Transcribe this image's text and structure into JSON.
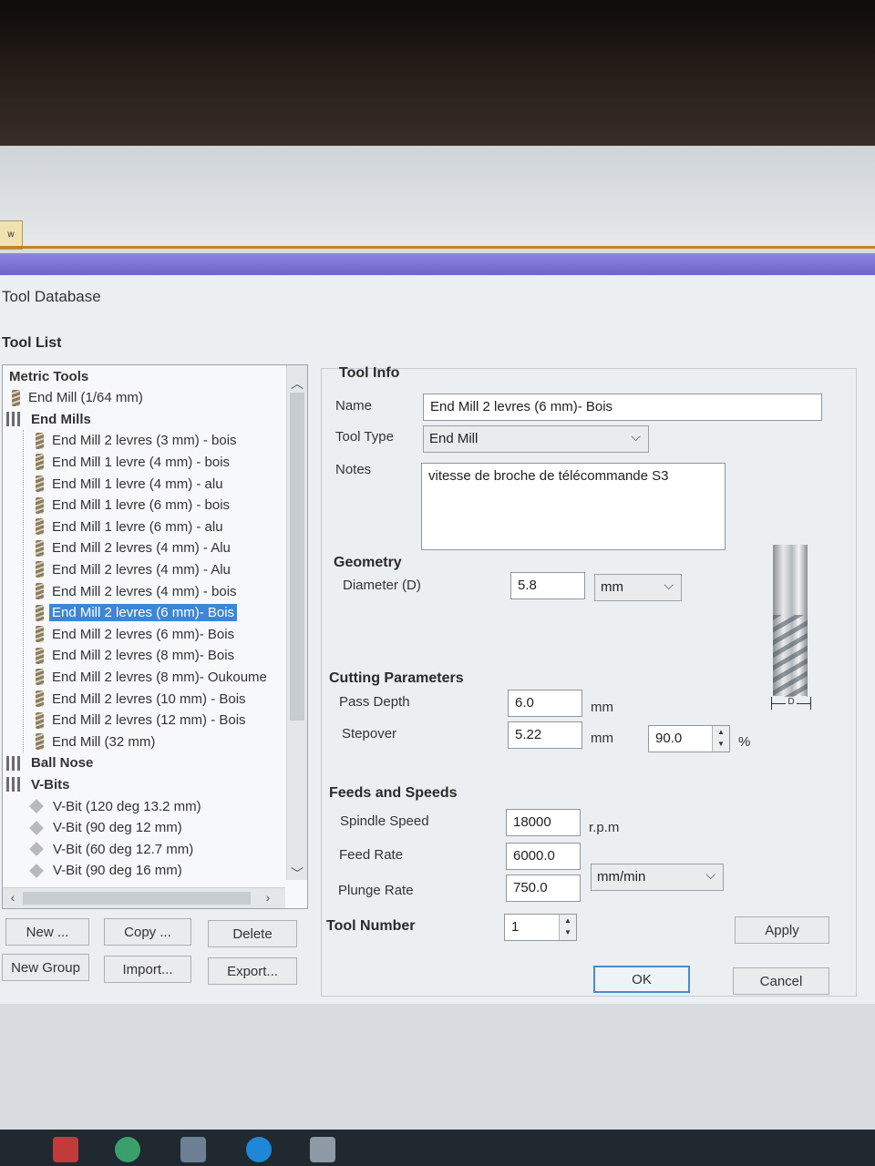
{
  "app_tab": {
    "label": "w"
  },
  "dialog": {
    "title": "Tool Database"
  },
  "tool_list": {
    "title": "Tool List",
    "items": [
      {
        "label": "Metric Tools",
        "kind": "root"
      },
      {
        "label": "End Mill (1/64 mm)",
        "kind": "tool"
      },
      {
        "label": "End Mills",
        "kind": "group"
      },
      {
        "label": "End Mill 2 levres (3 mm) - bois",
        "kind": "child"
      },
      {
        "label": "End Mill 1 levre (4 mm) - bois",
        "kind": "child"
      },
      {
        "label": "End Mill 1 levre (4 mm) - alu",
        "kind": "child"
      },
      {
        "label": "End Mill 1 levre (6 mm) - bois",
        "kind": "child"
      },
      {
        "label": "End Mill 1 levre (6 mm) - alu",
        "kind": "child"
      },
      {
        "label": "End Mill 2 levres (4 mm) - Alu",
        "kind": "child"
      },
      {
        "label": "End Mill 2 levres (4 mm) - Alu",
        "kind": "child"
      },
      {
        "label": "End Mill 2 levres (4 mm) - bois",
        "kind": "child"
      },
      {
        "label": "End Mill 2 levres (6 mm)- Bois",
        "kind": "child",
        "selected": true
      },
      {
        "label": "End Mill 2 levres (6 mm)- Bois",
        "kind": "child"
      },
      {
        "label": "End Mill 2 levres (8 mm)- Bois",
        "kind": "child"
      },
      {
        "label": "End Mill 2 levres (8 mm)- Oukoume",
        "kind": "child"
      },
      {
        "label": "End Mill 2 levres (10 mm) - Bois",
        "kind": "child"
      },
      {
        "label": "End Mill 2 levres (12 mm) - Bois",
        "kind": "child"
      },
      {
        "label": "End Mill (32 mm)",
        "kind": "child"
      },
      {
        "label": "Ball Nose",
        "kind": "group"
      },
      {
        "label": "V-Bits",
        "kind": "group"
      },
      {
        "label": "V-Bit (120 deg 13.2 mm)",
        "kind": "vbit"
      },
      {
        "label": "V-Bit (90 deg 12 mm)",
        "kind": "vbit"
      },
      {
        "label": "V-Bit (60 deg 12.7 mm)",
        "kind": "vbit"
      },
      {
        "label": "V-Bit (90 deg 16 mm)",
        "kind": "vbit"
      }
    ]
  },
  "buttons": {
    "new": "New ...",
    "copy": "Copy ...",
    "delete": "Delete",
    "new_group": "New Group",
    "import": "Import...",
    "export": "Export...",
    "apply": "Apply",
    "ok": "OK",
    "cancel": "Cancel"
  },
  "tool_info": {
    "title": "Tool Info",
    "name_label": "Name",
    "name_value": "End Mill 2 levres (6 mm)- Bois",
    "type_label": "Tool Type",
    "type_value": "End Mill",
    "notes_label": "Notes",
    "notes_value": "vitesse de broche de télécommande S3"
  },
  "geometry": {
    "title": "Geometry",
    "diameter_label": "Diameter (D)",
    "diameter_value": "5.8",
    "unit_value": "mm",
    "diagram_label": "D"
  },
  "cutting": {
    "title": "Cutting Parameters",
    "pass_depth_label": "Pass Depth",
    "pass_depth_value": "6.0",
    "pass_depth_unit": "mm",
    "stepover_label": "Stepover",
    "stepover_value": "5.22",
    "stepover_unit": "mm",
    "stepover_percent": "90.0",
    "percent_sign": "%"
  },
  "feeds": {
    "title": "Feeds and Speeds",
    "spindle_label": "Spindle Speed",
    "spindle_value": "18000",
    "spindle_unit": "r.p.m",
    "feed_label": "Feed Rate",
    "feed_value": "6000.0",
    "plunge_label": "Plunge Rate",
    "plunge_value": "750.0",
    "rate_unit": "mm/min"
  },
  "tool_number": {
    "label": "Tool Number",
    "value": "1"
  },
  "colors": {
    "selection": "#3d86d6",
    "title_bar": "#7a72d6",
    "accent_rule": "#b98532"
  }
}
